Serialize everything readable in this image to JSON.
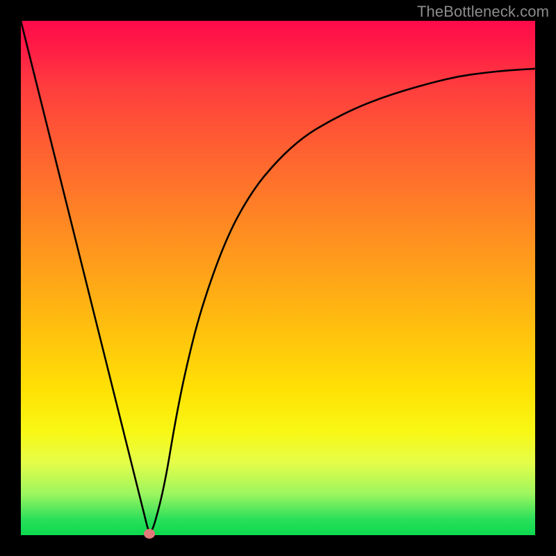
{
  "watermark": "TheBottleneck.com",
  "chart_data": {
    "type": "line",
    "title": "",
    "xlabel": "",
    "ylabel": "",
    "xlim": [
      0,
      100
    ],
    "ylim": [
      0,
      100
    ],
    "grid": false,
    "series": [
      {
        "name": "curve",
        "x": [
          0,
          5,
          10,
          15,
          20,
          22,
          24,
          25,
          26,
          28,
          30,
          32,
          35,
          40,
          45,
          50,
          55,
          60,
          65,
          70,
          75,
          80,
          85,
          90,
          95,
          100
        ],
        "values": [
          100,
          80,
          60,
          40,
          20,
          12,
          4,
          0,
          2,
          10,
          22,
          32,
          44,
          58,
          67,
          73,
          77.5,
          80.5,
          83,
          85,
          86.6,
          88,
          89.2,
          89.9,
          90.4,
          90.7
        ]
      }
    ],
    "marker": {
      "x": 25,
      "y": 0
    },
    "gradient_colors": {
      "top": "#ff0a4a",
      "bottom": "#0dd94e"
    }
  }
}
